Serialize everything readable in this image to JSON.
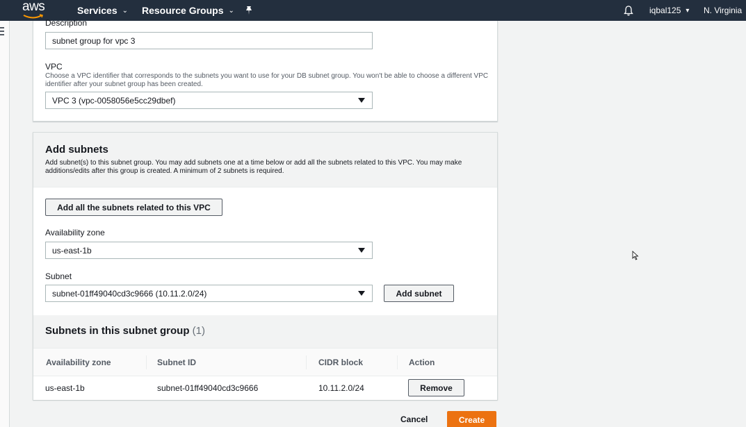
{
  "nav": {
    "logo": "aws",
    "services": "Services",
    "resource_groups": "Resource Groups",
    "user": "iqbal125",
    "region": "N. Virginia"
  },
  "form": {
    "description": {
      "label": "Description",
      "value": "subnet group for vpc 3"
    },
    "vpc": {
      "label": "VPC",
      "help": "Choose a VPC identifier that corresponds to the subnets you want to use for your DB subnet group. You won't be able to choose a different VPC identifier after your subnet group has been created.",
      "value": "VPC 3 (vpc-0058056e5cc29dbef)"
    }
  },
  "add_subnets": {
    "title": "Add subnets",
    "help": "Add subnet(s) to this subnet group. You may add subnets one at a time below or add all the subnets related to this VPC. You may make additions/edits after this group is created. A minimum of 2 subnets is required.",
    "add_all_label": "Add all the subnets related to this VPC",
    "az_label": "Availability zone",
    "az_value": "us-east-1b",
    "subnet_label": "Subnet",
    "subnet_value": "subnet-01ff49040cd3c9666 (10.11.2.0/24)",
    "add_subnet_label": "Add subnet"
  },
  "group": {
    "title": "Subnets in this subnet group",
    "count": "(1)",
    "columns": [
      "Availability zone",
      "Subnet ID",
      "CIDR block",
      "Action"
    ],
    "rows": [
      {
        "az": "us-east-1b",
        "subnet_id": "subnet-01ff49040cd3c9666",
        "cidr": "10.11.2.0/24",
        "action": "Remove"
      }
    ]
  },
  "footer": {
    "cancel": "Cancel",
    "create": "Create"
  },
  "colors": {
    "nav_bg": "#232f3e",
    "primary": "#ec7211"
  }
}
